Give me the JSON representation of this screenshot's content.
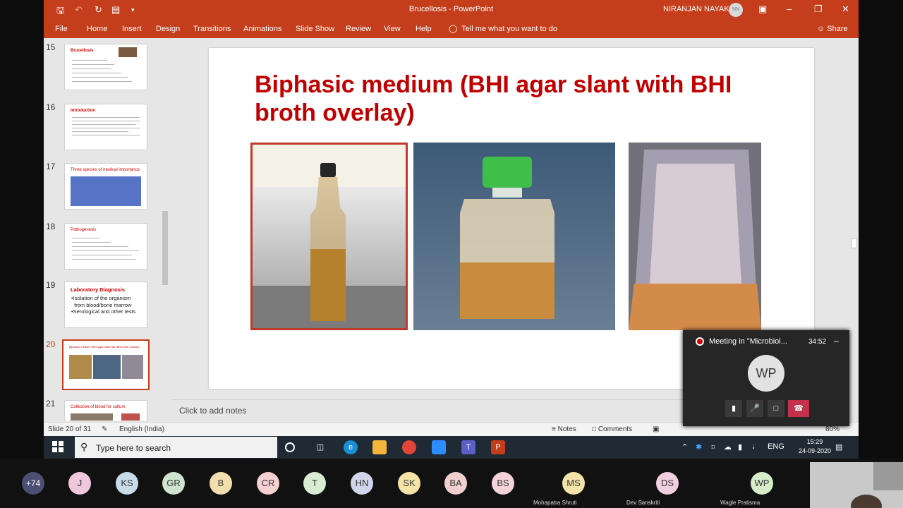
{
  "window": {
    "title": "Brucellosis  -  PowerPoint",
    "user": "NIRANJAN NAYAK",
    "user_initials": "NN"
  },
  "ribbon": {
    "tabs": [
      "File",
      "Home",
      "Insert",
      "Design",
      "Transitions",
      "Animations",
      "Slide Show",
      "Review",
      "View",
      "Help"
    ],
    "tell_me": "Tell me what you want to do",
    "share": "Share"
  },
  "thumbnails": [
    {
      "num": "15",
      "title": "Brucellosis"
    },
    {
      "num": "16",
      "title": "Introduction"
    },
    {
      "num": "17",
      "title": "Three species of medical importance"
    },
    {
      "num": "18",
      "title": "Pathogenesis"
    },
    {
      "num": "19",
      "title": "Laboratory Diagnosis",
      "body": "•Isolation of the organism\n  from blood/bone marrow\n•Serological and other tests"
    },
    {
      "num": "20",
      "title": "Biphasic medium (BHI agar slant with BHI broth overlay)"
    },
    {
      "num": "21",
      "title": "Collection of blood for culture"
    }
  ],
  "slide": {
    "title": "Biphasic medium (BHI agar slant with BHI broth overlay)"
  },
  "notes_placeholder": "Click to add notes",
  "status": {
    "slide_info": "Slide 20 of 31",
    "language": "English (India)",
    "notes": "Notes",
    "comments": "Comments",
    "zoom": "80%"
  },
  "meeting": {
    "title": "Meeting in \"Microbiol...",
    "time": "34:52",
    "initials": "WP"
  },
  "taskbar": {
    "search_placeholder": "Type here to search",
    "lang": "ENG",
    "time": "15:29",
    "date": "24-09-2020"
  },
  "participants": [
    {
      "initials": "+74",
      "color": "#4b4f73",
      "name": ""
    },
    {
      "initials": "J",
      "color": "#f0c8de",
      "name": ""
    },
    {
      "initials": "KS",
      "color": "#c8dce8",
      "name": ""
    },
    {
      "initials": "GR",
      "color": "#cfe4cf",
      "name": ""
    },
    {
      "initials": "B",
      "color": "#f3dfae",
      "name": ""
    },
    {
      "initials": "CR",
      "color": "#f4d0d0",
      "name": ""
    },
    {
      "initials": "T",
      "color": "#d9ecd2",
      "name": ""
    },
    {
      "initials": "HN",
      "color": "#cfd6ec",
      "name": ""
    },
    {
      "initials": "SK",
      "color": "#f4e4a8",
      "name": ""
    },
    {
      "initials": "BA",
      "color": "#f2cfcf",
      "name": ""
    },
    {
      "initials": "BS",
      "color": "#f4d3d8",
      "name": ""
    },
    {
      "initials": "MS",
      "color": "#f4e4a8",
      "name": "Mohapatra Shruti"
    },
    {
      "initials": "DS",
      "color": "#f2cfe0",
      "name": "Dev Sanskriti"
    },
    {
      "initials": "WP",
      "color": "#d6ecc9",
      "name": "Wagle Pratisma"
    }
  ]
}
